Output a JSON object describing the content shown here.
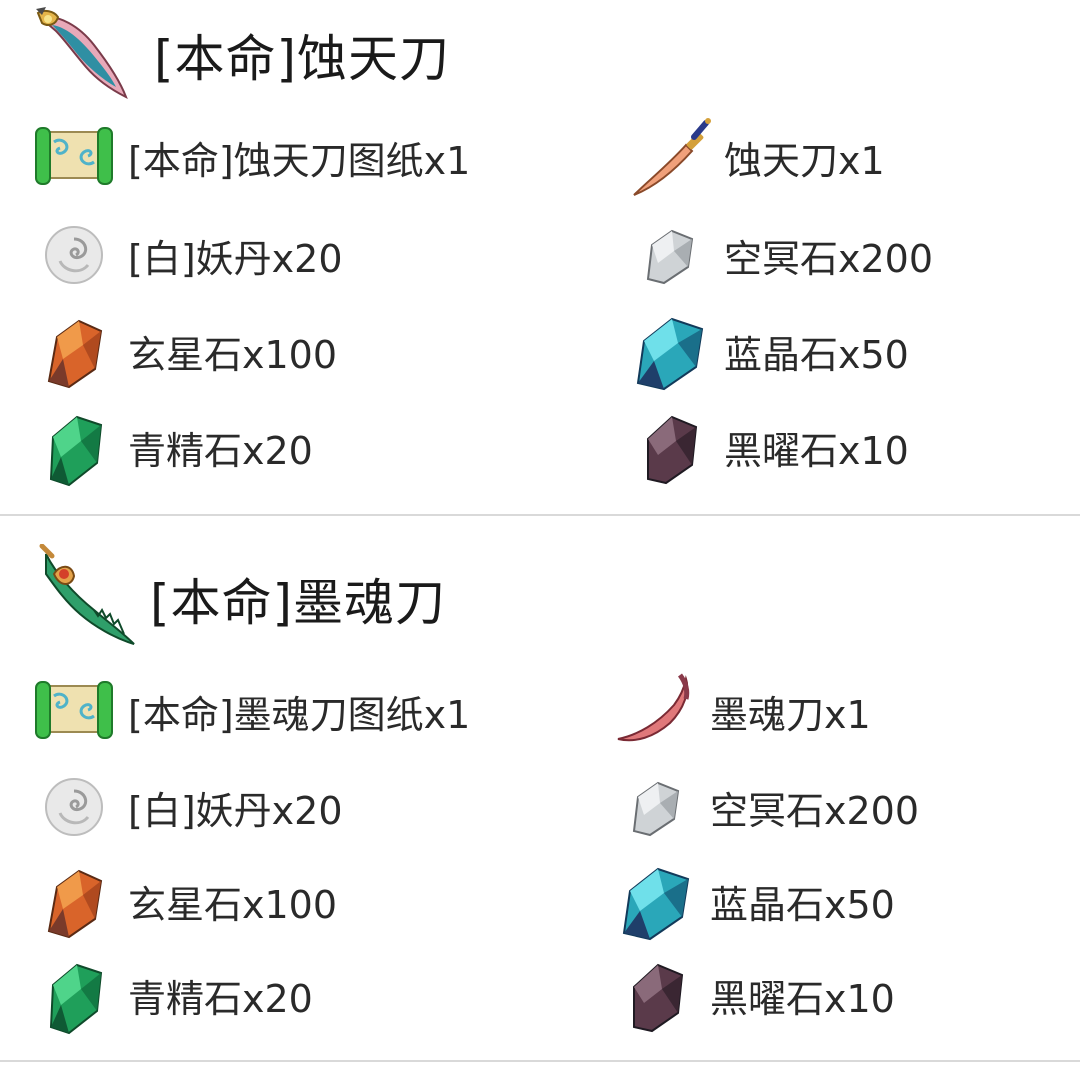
{
  "recipes": [
    {
      "title": "[本命]蚀天刀",
      "icon": "weapon-blade-icon",
      "materials": [
        {
          "label": "[本命]蚀天刀图纸x1",
          "icon": "scroll-icon"
        },
        {
          "label": "蚀天刀x1",
          "icon": "dagger-icon"
        },
        {
          "label": "[白]妖丹x20",
          "icon": "white-pill-icon"
        },
        {
          "label": "空冥石x200",
          "icon": "silver-stone-icon"
        },
        {
          "label": "玄星石x100",
          "icon": "orange-crystal-icon"
        },
        {
          "label": "蓝晶石x50",
          "icon": "blue-crystal-icon"
        },
        {
          "label": "青精石x20",
          "icon": "green-crystal-icon"
        },
        {
          "label": "黑曜石x10",
          "icon": "obsidian-icon"
        }
      ]
    },
    {
      "title": "[本命]墨魂刀",
      "icon": "weapon-blade-icon",
      "materials": [
        {
          "label": "[本命]墨魂刀图纸x1",
          "icon": "scroll-icon"
        },
        {
          "label": "墨魂刀x1",
          "icon": "curved-blade-icon"
        },
        {
          "label": "[白]妖丹x20",
          "icon": "white-pill-icon"
        },
        {
          "label": "空冥石x200",
          "icon": "silver-stone-icon"
        },
        {
          "label": "玄星石x100",
          "icon": "orange-crystal-icon"
        },
        {
          "label": "蓝晶石x50",
          "icon": "blue-crystal-icon"
        },
        {
          "label": "青精石x20",
          "icon": "green-crystal-icon"
        },
        {
          "label": "黑曜石x10",
          "icon": "obsidian-icon"
        }
      ]
    }
  ],
  "colors": {
    "divider": "#d9d9d9",
    "text": "#2a2a2a"
  }
}
